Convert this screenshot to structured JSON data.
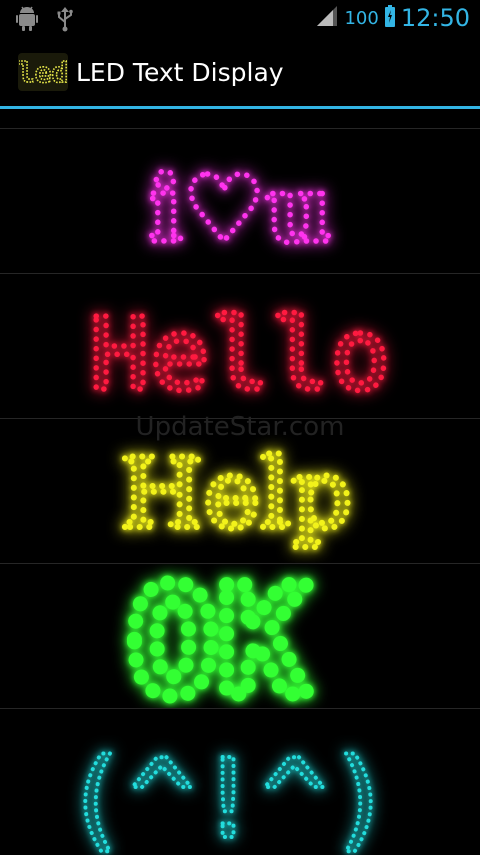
{
  "status_bar": {
    "battery_level": "100",
    "time": "12:50",
    "icons": [
      "android-debug-icon",
      "usb-icon",
      "signal-icon",
      "battery-icon"
    ]
  },
  "action_bar": {
    "icon_text": "led",
    "title": "LED Text Display"
  },
  "watermark": "UpdateStar.com",
  "list_items": [
    {
      "text": "i♥u",
      "color": "#ff33ee"
    },
    {
      "text": "Hello",
      "color": "#ff1a40"
    },
    {
      "text": "Help",
      "color": "#f2f21a"
    },
    {
      "text": "OK",
      "color": "#33ff33"
    },
    {
      "text": "(^!^)",
      "color": "#22dddd"
    }
  ],
  "colors": {
    "accent": "#33b5e5",
    "background": "#000000",
    "divider": "#262626"
  }
}
